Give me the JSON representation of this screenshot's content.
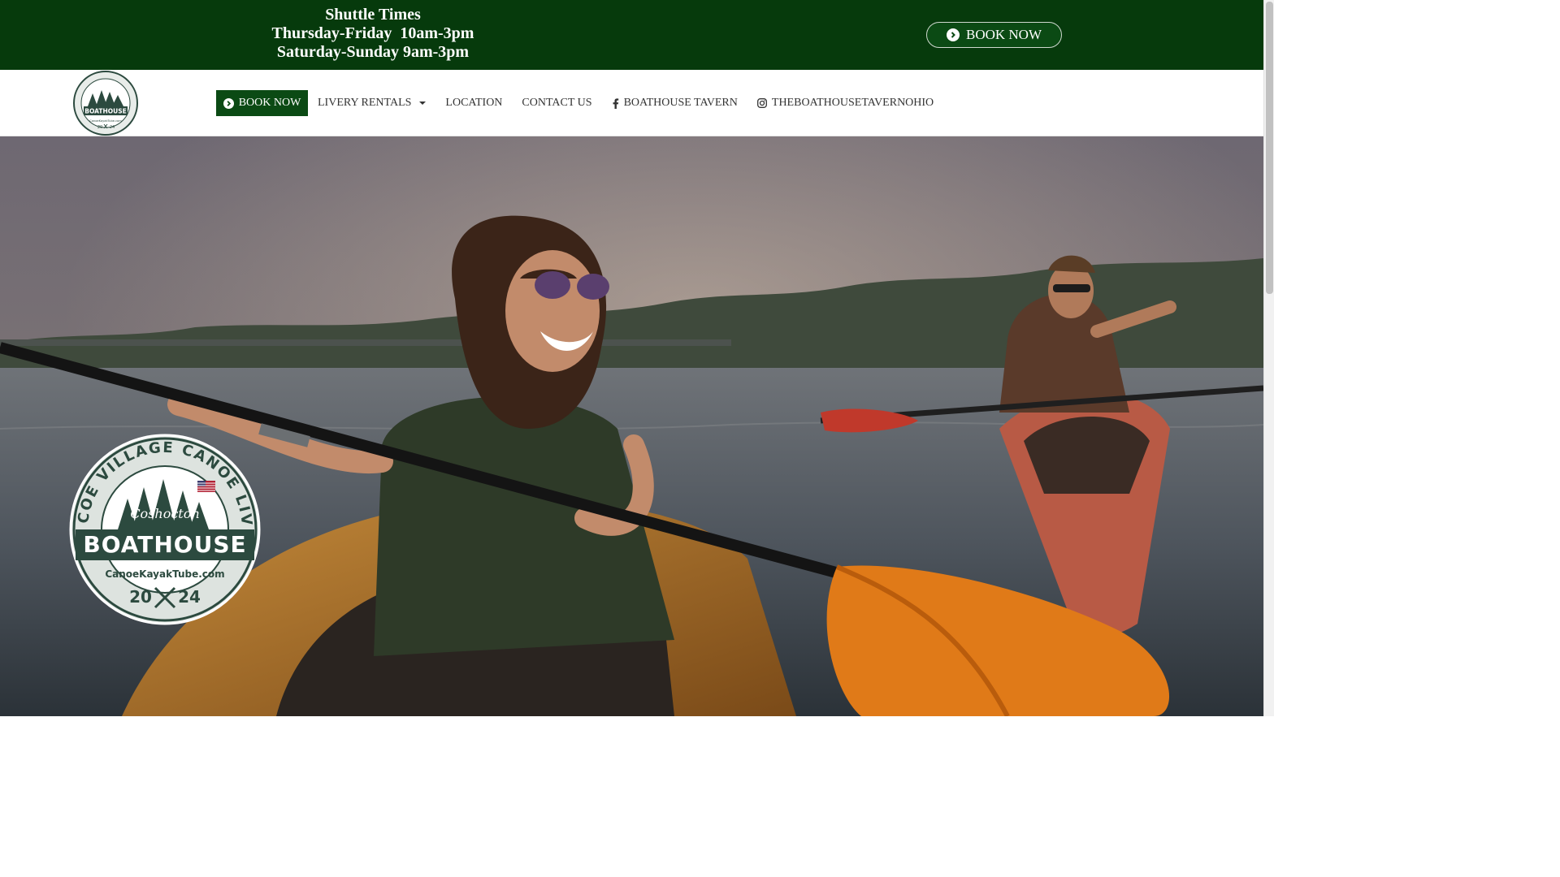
{
  "topbar": {
    "shuttle_title": "Shuttle Times",
    "shuttle_line1": "Thursday-Friday  10am-3pm",
    "shuttle_line2": "Saturday-Sunday 9am-3pm",
    "book_label": "BOOK NOW",
    "book_icon": "circle-chevron-right-icon",
    "background_color": "#063a0c"
  },
  "logo": {
    "ring_text": "ROSCOE VILLAGE CANOE LIVERY",
    "town": "Coshocton",
    "name": "BOATHOUSE",
    "site": "CanoeKayakTube.com",
    "year_left": "20",
    "year_right": "24"
  },
  "nav": {
    "book_label": "BOOK NOW",
    "book_icon": "circle-chevron-right-icon",
    "livery_label": "LIVERY RENTALS",
    "location_label": "LOCATION",
    "contact_label": "CONTACT US",
    "tavern_label": "BOATHOUSE TAVERN",
    "tavern_icon": "facebook-icon",
    "instagram_label": "THEBOATHOUSETAVERNOHIO",
    "instagram_icon": "instagram-icon",
    "accent_color": "#0b4a14"
  },
  "hero": {
    "description_icon": "kayakers-photo"
  }
}
